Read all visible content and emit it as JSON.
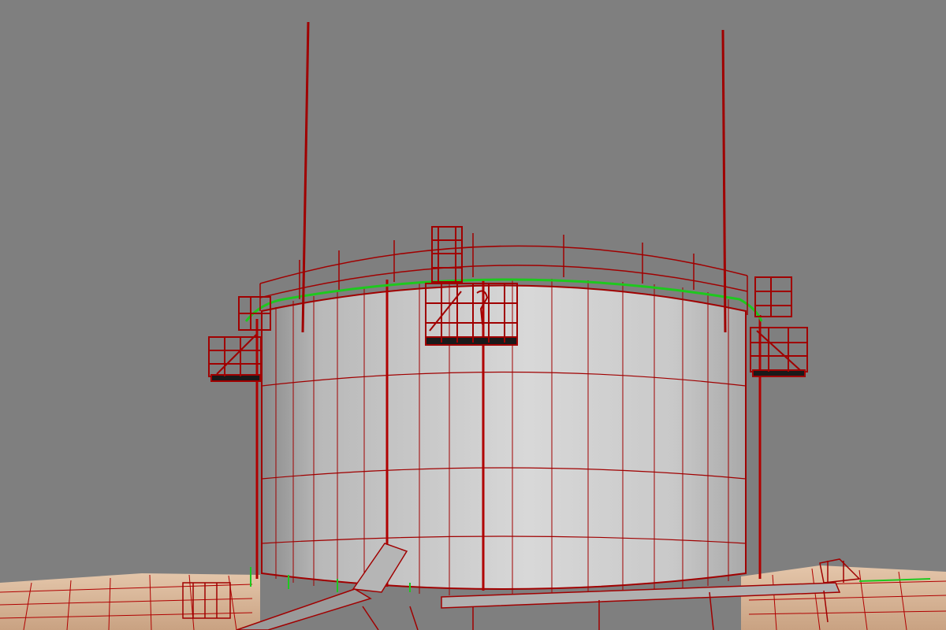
{
  "viewport": {
    "kind": "3d-wireframe-perspective-viewport",
    "background_color": "#7f7f7f",
    "wire_color": "#a00000",
    "selection_color": "#1ec81e",
    "tank_shade_light": "#d4d4d4",
    "tank_shade_dark": "#8a8a8a",
    "ground_color": "#d9b89a"
  },
  "scene_objects": [
    {
      "name": "storage-tank",
      "type": "cylinder-mesh",
      "selected": false
    },
    {
      "name": "tank-roof-rim",
      "type": "edge-loop",
      "selected": true
    },
    {
      "name": "lightning-rod-left",
      "type": "mast"
    },
    {
      "name": "lightning-rod-right",
      "type": "mast"
    },
    {
      "name": "top-handrail",
      "type": "railing"
    },
    {
      "name": "center-platform",
      "type": "platform"
    },
    {
      "name": "left-platform",
      "type": "platform"
    },
    {
      "name": "right-platform",
      "type": "platform"
    },
    {
      "name": "stair-tower",
      "type": "stairs"
    },
    {
      "name": "ground-terrain",
      "type": "terrain-mesh"
    },
    {
      "name": "pipe-rack",
      "type": "pipes"
    }
  ]
}
